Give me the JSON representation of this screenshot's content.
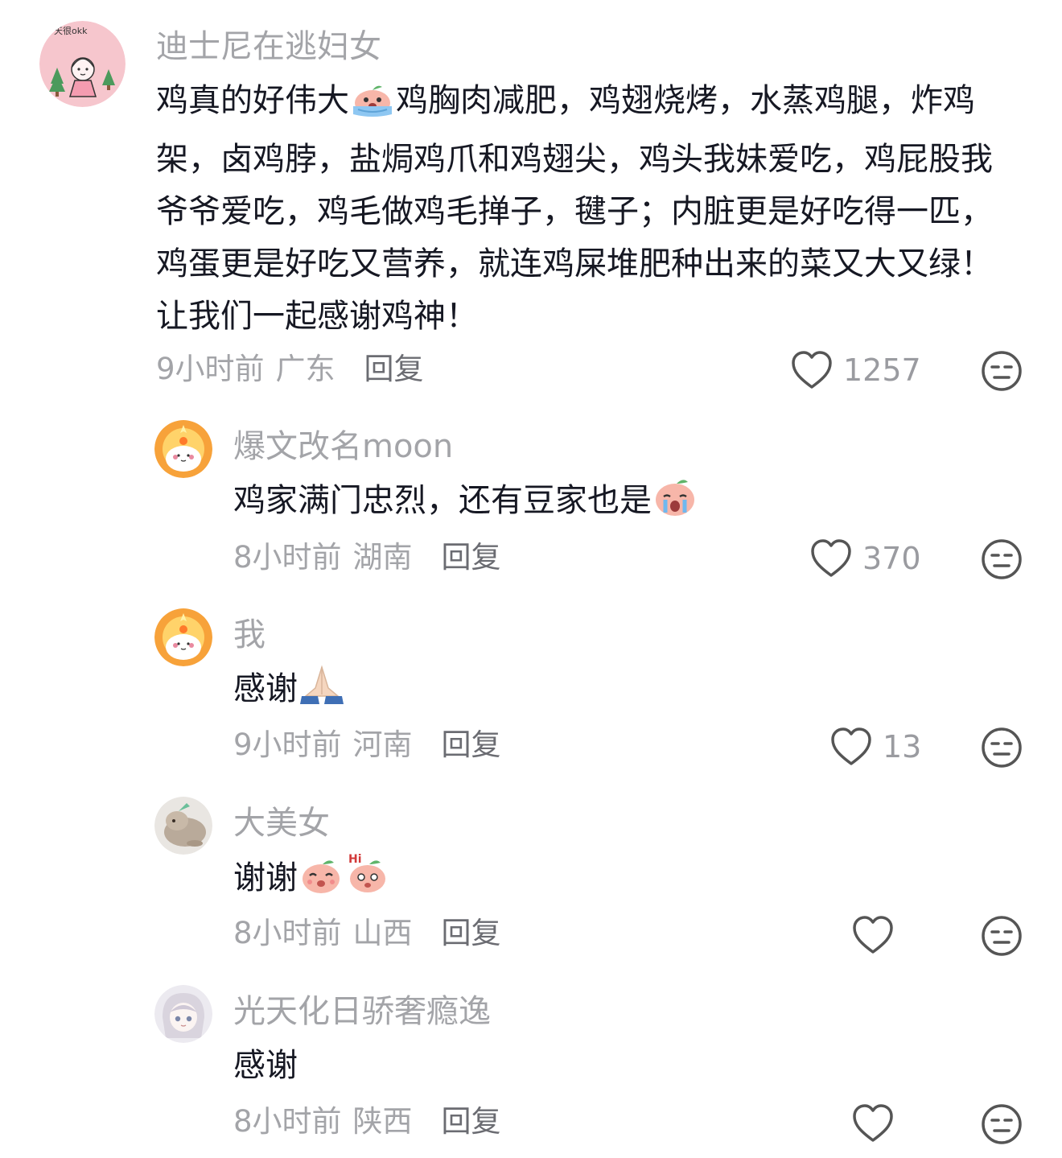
{
  "comments": [
    {
      "author": "迪士尼在逃妇女",
      "avatar_text": "天很okk",
      "text_parts": [
        "鸡真的好伟大",
        "鸡胸肉减肥，鸡翅烧烤，水蒸鸡腿，炸鸡架，卤鸡脖，盐焗鸡爪和鸡翅尖，鸡头我妹爱吃，鸡屁股我爷爷爱吃，鸡毛做鸡毛掸子，毽子；内脏更是好吃得一匹，鸡蛋更是好吃又营养，就连鸡屎堆肥种出来的菜又大又绿！让我们一起感谢鸡神！"
      ],
      "emoji": "crying-peach-sticker",
      "time": "9小时前",
      "region": "广东",
      "reply_label": "回复",
      "likes": "1257"
    },
    {
      "author": "爆文改名moon",
      "text": "鸡家满门忠烈，还有豆家也是",
      "emoji": "sobbing-peach-sticker",
      "time": "8小时前",
      "region": "湖南",
      "reply_label": "回复",
      "likes": "370"
    },
    {
      "author": "我",
      "text": "感谢",
      "emoji": "folded-hands",
      "time": "9小时前",
      "region": "河南",
      "reply_label": "回复",
      "likes": "13"
    },
    {
      "author": "大美女",
      "text": "谢谢",
      "emoji": "happy-peach-and-hi-peach-stickers",
      "sticker_text": "Hi",
      "time": "8小时前",
      "region": "山西",
      "reply_label": "回复",
      "likes": ""
    },
    {
      "author": "光天化日骄奢瘾逸",
      "text": "感谢",
      "time": "8小时前",
      "region": "陕西",
      "reply_label": "回复",
      "likes": ""
    }
  ],
  "colors": {
    "primary_text": "#161823",
    "secondary_text": "#a3a4a8",
    "reply_text": "#6b6c72",
    "icon": "#555555",
    "background": "#ffffff"
  },
  "icons": {
    "like": "heart-outline-icon",
    "dislike": "neutral-face-icon"
  }
}
